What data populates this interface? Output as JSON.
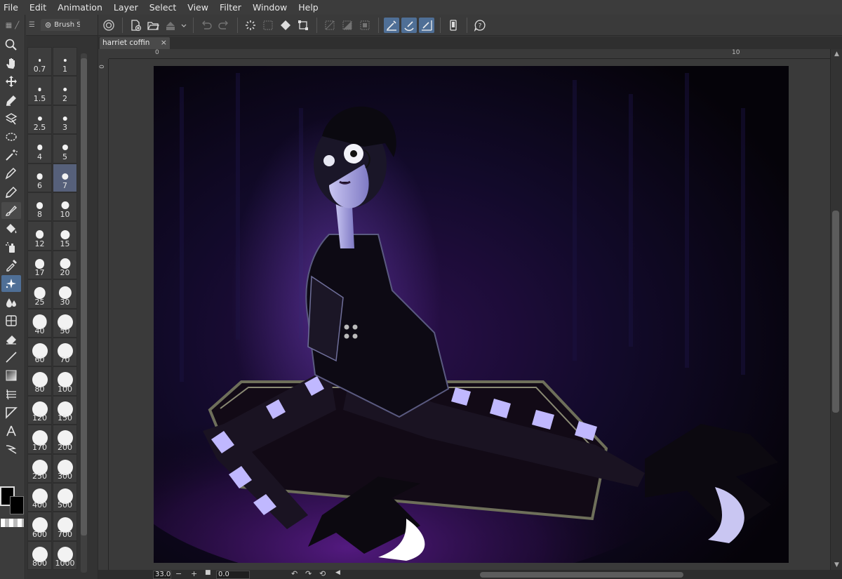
{
  "menu": [
    "File",
    "Edit",
    "Animation",
    "Layer",
    "Select",
    "View",
    "Filter",
    "Window",
    "Help"
  ],
  "brush_panel": {
    "tab_label": "Brush S"
  },
  "document": {
    "tab_title": "harriet coffin",
    "close_glyph": "×"
  },
  "ruler": {
    "h_labels": [
      "0",
      "10"
    ],
    "v_labels": [
      "0"
    ]
  },
  "brush_sizes": {
    "selected": "7",
    "items": [
      "0.7",
      "1",
      "1.5",
      "2",
      "2.5",
      "3",
      "4",
      "5",
      "6",
      "7",
      "8",
      "10",
      "12",
      "15",
      "17",
      "20",
      "25",
      "30",
      "40",
      "50",
      "60",
      "70",
      "80",
      "100",
      "120",
      "150",
      "170",
      "200",
      "250",
      "300",
      "400",
      "500",
      "600",
      "700",
      "800",
      "1000"
    ]
  },
  "status": {
    "zoom": "33.0",
    "rotation": "0.0",
    "minus": "−",
    "plus": "+"
  },
  "tools": [
    "zoom-icon",
    "hand-icon",
    "move-icon",
    "operation-icon",
    "layer-move-icon",
    "selection-icon",
    "magic-wand-icon",
    "pen-icon",
    "pencil-icon",
    "brush-icon",
    "fill-icon",
    "airbrush-icon",
    "eyedropper-icon",
    "decoration-icon",
    "blend-icon",
    "figure-icon",
    "eraser-icon",
    "line-icon",
    "gradient-icon",
    "ruler-icon",
    "frame-icon",
    "text-icon",
    "balloon-icon"
  ],
  "active_tool": "decoration-icon",
  "colors": {
    "main": "#000000",
    "sub": "#000000",
    "accent": "#4f6f96"
  }
}
